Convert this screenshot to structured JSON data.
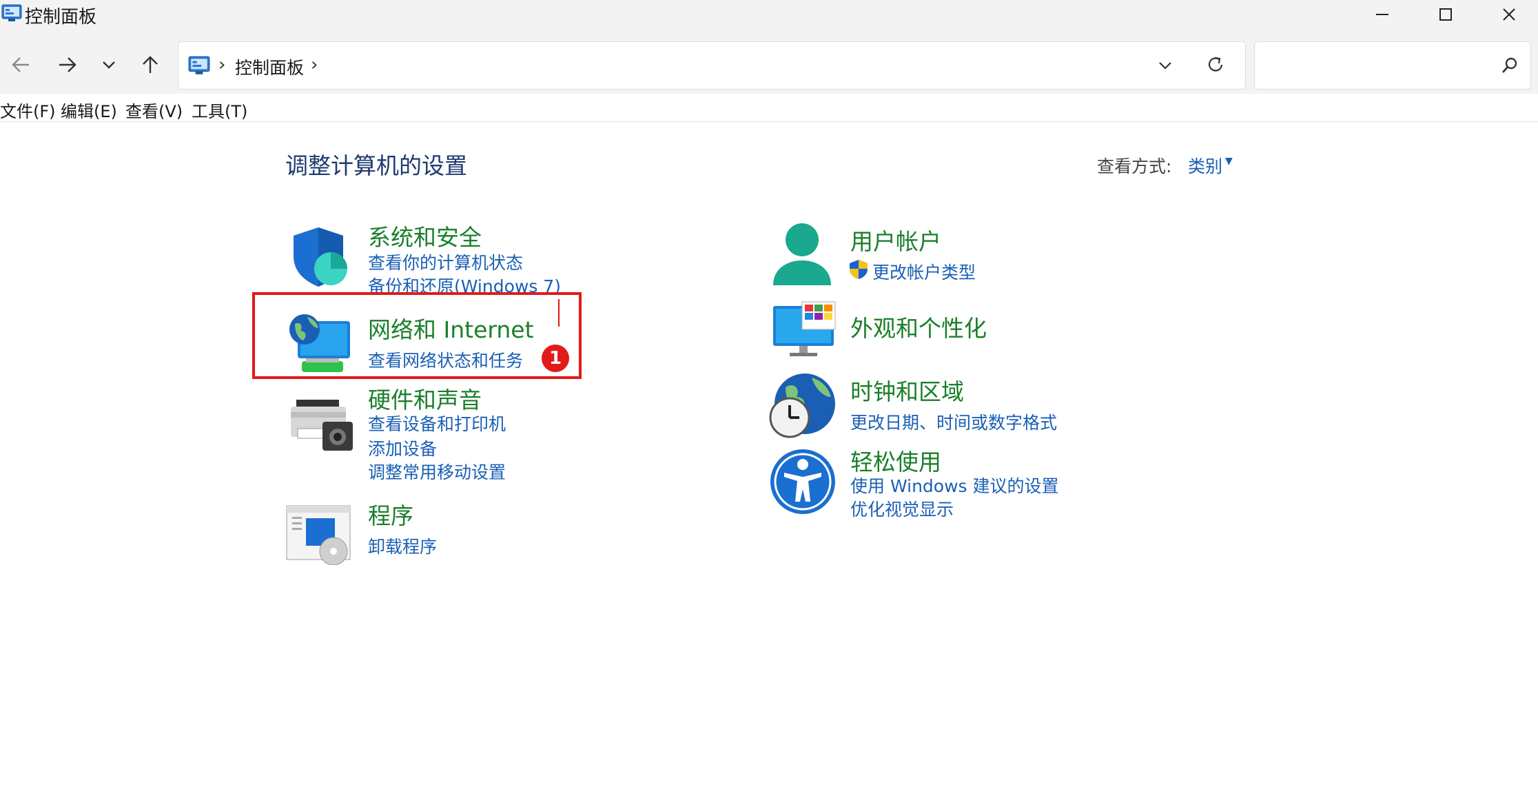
{
  "window": {
    "title": "控制面板",
    "controls": {
      "minimize": "minimize-icon",
      "maximize": "maximize-icon",
      "close": "close-icon"
    }
  },
  "nav": {
    "back": "arrow-left-icon",
    "forward": "arrow-right-icon",
    "recent": "chevron-down-icon",
    "up": "arrow-up-icon"
  },
  "address": {
    "crumb": "控制面板",
    "separator": "›"
  },
  "search": {
    "placeholder": ""
  },
  "menu": {
    "file": "文件(F)",
    "edit": "编辑(E)",
    "view": "查看(V)",
    "tools": "工具(T)"
  },
  "content": {
    "title": "调整计算机的设置",
    "view_by_label": "查看方式:",
    "view_by_value": "类别",
    "categories": [
      {
        "title": "系统和安全",
        "links": [
          "查看你的计算机状态",
          "备份和还原(Windows 7)"
        ]
      },
      {
        "title": "网络和 Internet",
        "links": [
          "查看网络状态和任务"
        ]
      },
      {
        "title": "硬件和声音",
        "links": [
          "查看设备和打印机",
          "添加设备",
          "调整常用移动设置"
        ]
      },
      {
        "title": "程序",
        "links": [
          "卸载程序"
        ]
      },
      {
        "title": "用户帐户",
        "links": [
          "更改帐户类型"
        ]
      },
      {
        "title": "外观和个性化",
        "links": []
      },
      {
        "title": "时钟和区域",
        "links": [
          "更改日期、时间或数字格式"
        ]
      },
      {
        "title": "轻松使用",
        "links": [
          "使用 Windows 建议的设置",
          "优化视觉显示"
        ]
      }
    ]
  },
  "annotation": {
    "badge": "1",
    "color": "#e11a1a"
  },
  "colors": {
    "link": "#1a5fb4",
    "category_title": "#1a7f2a",
    "page_title": "#1e3a6e",
    "chrome": "#f3f3f3"
  }
}
